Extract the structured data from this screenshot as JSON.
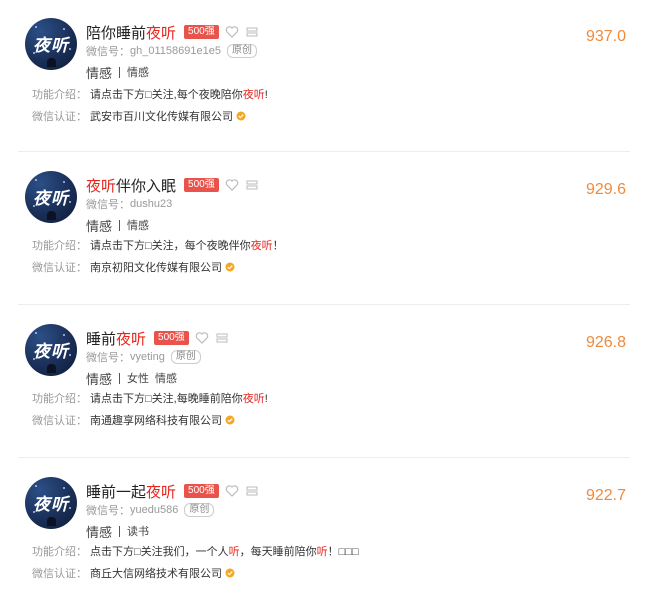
{
  "labels": {
    "wechat_id_prefix": "微信号：",
    "intro_label": "功能介绍：",
    "verify_label": "微信认证："
  },
  "colors": {
    "highlight": "#e6261e",
    "score": "#f08a3c",
    "badge": "#e8534b",
    "verify": "#f5a623"
  },
  "accounts": [
    {
      "avatar_logo_text": "夜听",
      "title_pre": "陪你睡前",
      "title_hl": "夜听",
      "title_post": "",
      "badge": "500强",
      "wechat_id": "gh_01158691e1e5",
      "original_tag": "原创",
      "category": "情感",
      "tags": [
        "情感"
      ],
      "intro_pre": "请点击下方□关注,每个夜晚陪你",
      "intro_hl": "夜听",
      "intro_post": "!",
      "intro_hl2": "",
      "intro_post2": "",
      "verified_by": "武安市百川文化传媒有限公司",
      "score": "937.0"
    },
    {
      "avatar_logo_text": "夜听",
      "title_pre": "",
      "title_hl": "夜听",
      "title_post": "伴你入眠",
      "badge": "500强",
      "wechat_id": "dushu23",
      "original_tag": "",
      "category": "情感",
      "tags": [
        "情感"
      ],
      "intro_pre": "请点击下方□关注，每个夜晚伴你",
      "intro_hl": "夜听",
      "intro_post": "！",
      "intro_hl2": "",
      "intro_post2": "",
      "verified_by": "南京初阳文化传媒有限公司",
      "score": "929.6"
    },
    {
      "avatar_logo_text": "夜听",
      "title_pre": "睡前",
      "title_hl": "夜听",
      "title_post": "",
      "badge": "500强",
      "wechat_id": "vyeting",
      "original_tag": "原创",
      "category": "情感",
      "tags": [
        "女性",
        "情感"
      ],
      "intro_pre": "请点击下方□关注,每晚睡前陪你",
      "intro_hl": "夜听",
      "intro_post": "!",
      "intro_hl2": "",
      "intro_post2": "",
      "verified_by": "南通趣享网络科技有限公司",
      "score": "926.8"
    },
    {
      "avatar_logo_text": "夜听",
      "title_pre": "睡前一起",
      "title_hl": "夜听",
      "title_post": "",
      "badge": "500强",
      "wechat_id": "yuedu586",
      "original_tag": "原创",
      "category": "情感",
      "tags": [
        "读书"
      ],
      "intro_pre": "点击下方□关注我们，一个人",
      "intro_hl": "听",
      "intro_post": "，每天睡前陪你",
      "intro_hl2": "听",
      "intro_post2": "！□□□",
      "verified_by": "商丘大信网络技术有限公司",
      "score": "922.7"
    }
  ]
}
